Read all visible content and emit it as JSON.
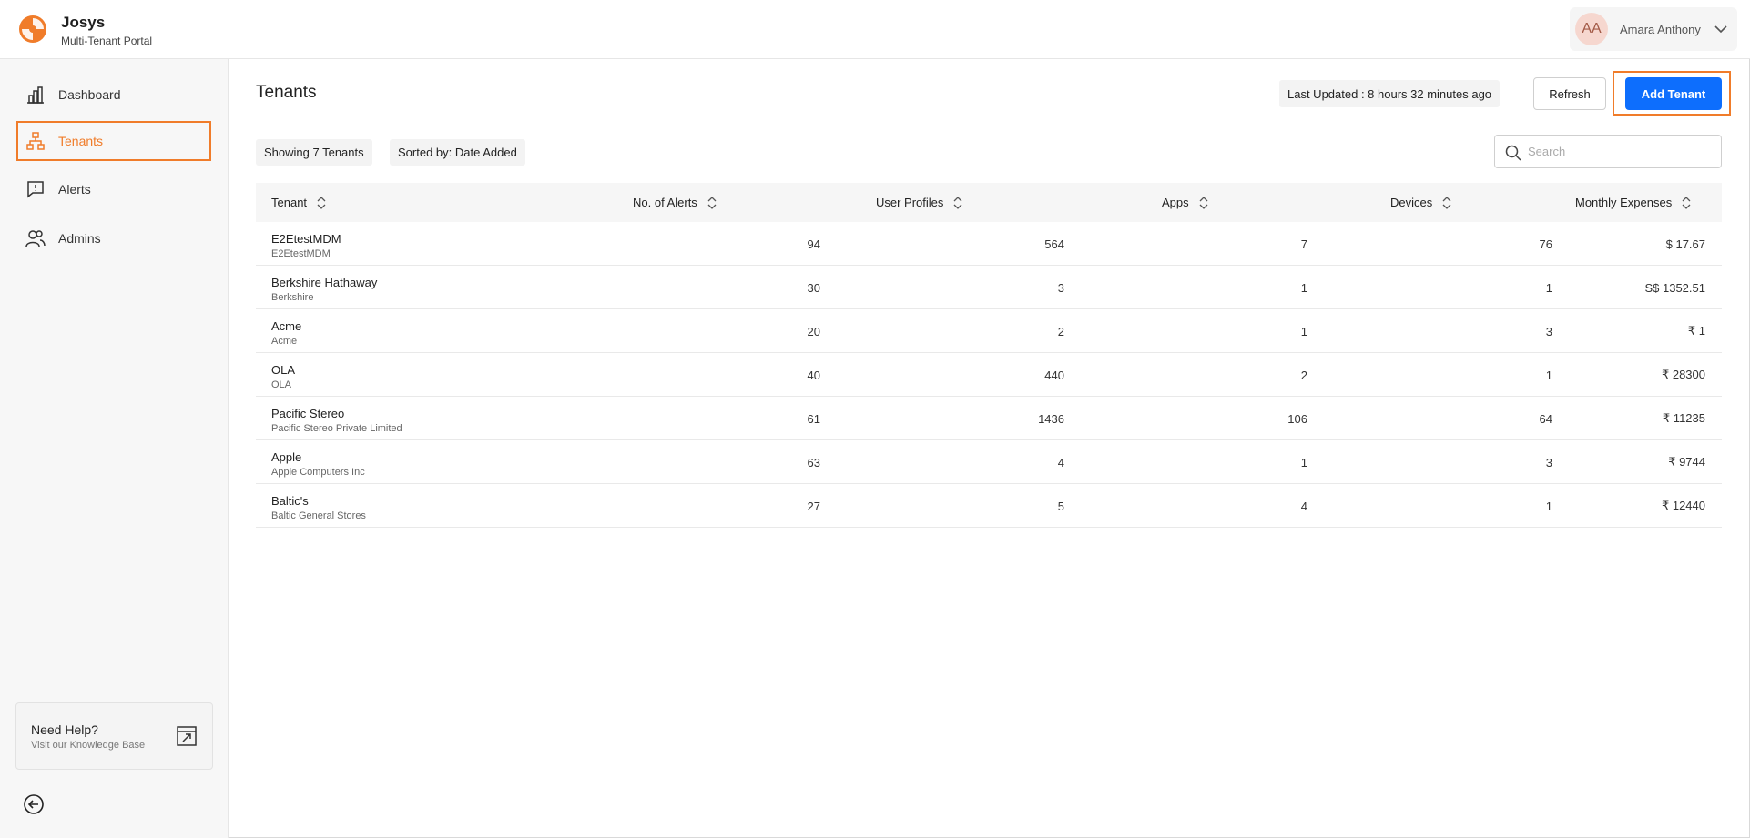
{
  "brand": {
    "name": "Josys",
    "subtitle": "Multi-Tenant Portal"
  },
  "user": {
    "initials": "AA",
    "name": "Amara Anthony"
  },
  "sidebar": {
    "items": [
      {
        "label": "Dashboard",
        "icon": "bar-chart-icon"
      },
      {
        "label": "Tenants",
        "icon": "hierarchy-icon",
        "active": true
      },
      {
        "label": "Alerts",
        "icon": "alert-message-icon"
      },
      {
        "label": "Admins",
        "icon": "users-icon"
      }
    ],
    "help": {
      "title": "Need Help?",
      "subtitle": "Visit our Knowledge Base"
    }
  },
  "main": {
    "title": "Tenants",
    "last_updated": "Last Updated : 8 hours 32 minutes ago",
    "refresh_label": "Refresh",
    "add_label": "Add Tenant",
    "showing": "Showing 7 Tenants",
    "sorted_by": "Sorted by: Date Added",
    "search_placeholder": "Search"
  },
  "table": {
    "columns": [
      "Tenant",
      "No. of Alerts",
      "User Profiles",
      "Apps",
      "Devices",
      "Monthly Expenses"
    ],
    "rows": [
      {
        "name": "E2EtestMDM",
        "sub": "E2EtestMDM",
        "alerts": "94",
        "profiles": "564",
        "apps": "7",
        "devices": "76",
        "expenses": "$ 17.67"
      },
      {
        "name": "Berkshire Hathaway",
        "sub": "Berkshire",
        "alerts": "30",
        "profiles": "3",
        "apps": "1",
        "devices": "1",
        "expenses": "S$ 1352.51"
      },
      {
        "name": "Acme",
        "sub": "Acme",
        "alerts": "20",
        "profiles": "2",
        "apps": "1",
        "devices": "3",
        "expenses": "₹ 1"
      },
      {
        "name": "OLA",
        "sub": "OLA",
        "alerts": "40",
        "profiles": "440",
        "apps": "2",
        "devices": "1",
        "expenses": "₹ 28300"
      },
      {
        "name": "Pacific Stereo",
        "sub": "Pacific Stereo Private Limited",
        "alerts": "61",
        "profiles": "1436",
        "apps": "106",
        "devices": "64",
        "expenses": "₹ 11235"
      },
      {
        "name": "Apple",
        "sub": "Apple Computers Inc",
        "alerts": "63",
        "profiles": "4",
        "apps": "1",
        "devices": "3",
        "expenses": "₹ 9744"
      },
      {
        "name": "Baltic's",
        "sub": "Baltic General Stores",
        "alerts": "27",
        "profiles": "5",
        "apps": "4",
        "devices": "1",
        "expenses": "₹ 12440"
      }
    ]
  },
  "colors": {
    "accent": "#f07c2a",
    "primary": "#0d6efd"
  }
}
